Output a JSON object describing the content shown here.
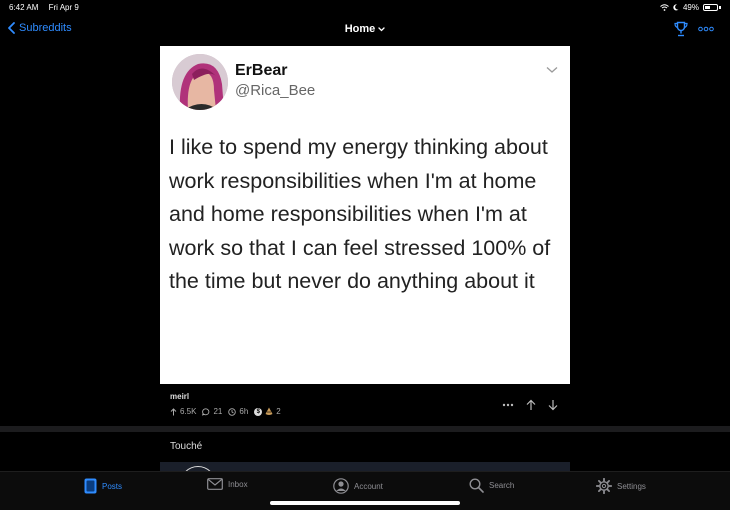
{
  "status_bar": {
    "time": "6:42 AM",
    "date": "Fri Apr 9",
    "battery": "49%",
    "battery_level": 0.49
  },
  "nav": {
    "back_label": "Subreddits",
    "title": "Home"
  },
  "post": {
    "tweet": {
      "name": "ErBear",
      "handle": "@Rica_Bee",
      "text": "I like to spend my energy thinking about work responsibilities when I'm at home and home responsibilities when I'm at work so that I can feel stressed 100% of the time but never do anything about it"
    },
    "subreddit": "meirl",
    "upvotes": "6.5K",
    "comments": "21",
    "age": "6h",
    "award_count": "2"
  },
  "next_post": {
    "title": "Touché"
  },
  "tabs": [
    {
      "label": "Posts",
      "icon": "posts-icon",
      "active": true
    },
    {
      "label": "Inbox",
      "icon": "inbox-icon"
    },
    {
      "label": "Account",
      "icon": "account-icon"
    },
    {
      "label": "Search",
      "icon": "search-icon"
    },
    {
      "label": "Settings",
      "icon": "settings-icon"
    }
  ],
  "colors": {
    "accent": "#2f8cff",
    "background": "#000000"
  }
}
